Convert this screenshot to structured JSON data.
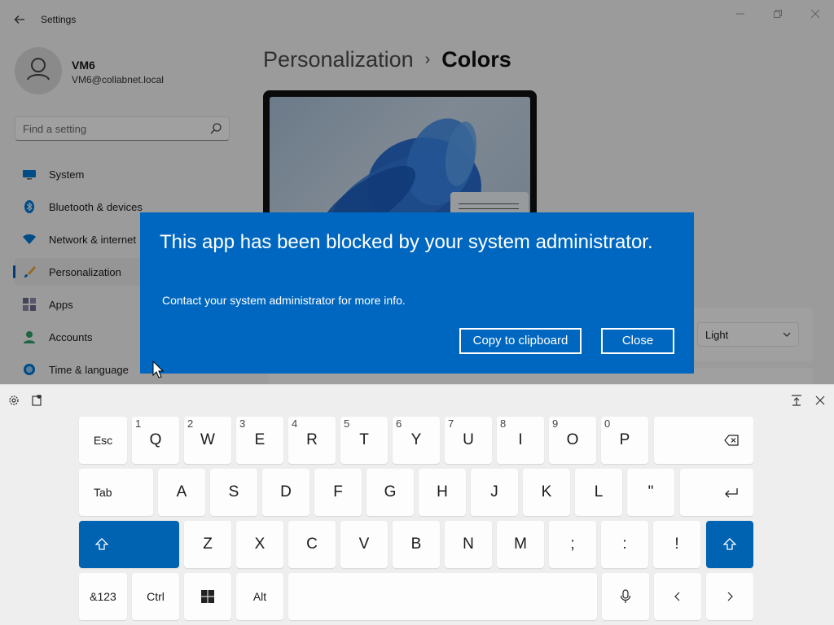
{
  "window": {
    "title": "Settings"
  },
  "profile": {
    "name": "VM6",
    "email": "VM6@collabnet.local"
  },
  "search": {
    "placeholder": "Find a setting"
  },
  "sidebar": {
    "items": [
      {
        "label": "System",
        "icon": "monitor-icon",
        "active": false
      },
      {
        "label": "Bluetooth & devices",
        "icon": "bluetooth-icon",
        "active": false
      },
      {
        "label": "Network & internet",
        "icon": "wifi-icon",
        "active": false
      },
      {
        "label": "Personalization",
        "icon": "brush-icon",
        "active": true
      },
      {
        "label": "Apps",
        "icon": "apps-icon",
        "active": false
      },
      {
        "label": "Accounts",
        "icon": "person-icon",
        "active": false
      },
      {
        "label": "Time & language",
        "icon": "globe-clock-icon",
        "active": false
      }
    ]
  },
  "breadcrumb": {
    "parent": "Personalization",
    "separator": "›",
    "current": "Colors"
  },
  "mode": {
    "value": "Light"
  },
  "dialog": {
    "title": "This app has been blocked by your system administrator.",
    "message": "Contact your system administrator for more info.",
    "copy_label": "Copy to clipboard",
    "close_label": "Close"
  },
  "keyboard": {
    "rows": [
      [
        {
          "label": "Esc"
        },
        {
          "label": "Q",
          "secondary": "1"
        },
        {
          "label": "W",
          "secondary": "2"
        },
        {
          "label": "E",
          "secondary": "3"
        },
        {
          "label": "R",
          "secondary": "4"
        },
        {
          "label": "T",
          "secondary": "5"
        },
        {
          "label": "Y",
          "secondary": "6"
        },
        {
          "label": "U",
          "secondary": "7"
        },
        {
          "label": "I",
          "secondary": "8"
        },
        {
          "label": "O",
          "secondary": "9"
        },
        {
          "label": "P",
          "secondary": "0"
        },
        {
          "label": "",
          "icon": "backspace-icon"
        }
      ],
      [
        {
          "label": "Tab"
        },
        {
          "label": "A"
        },
        {
          "label": "S"
        },
        {
          "label": "D"
        },
        {
          "label": "F"
        },
        {
          "label": "G"
        },
        {
          "label": "H"
        },
        {
          "label": "J"
        },
        {
          "label": "K"
        },
        {
          "label": "L"
        },
        {
          "label": "\""
        },
        {
          "label": "",
          "icon": "enter-icon"
        }
      ],
      [
        {
          "label": "",
          "icon": "shift-icon"
        },
        {
          "label": "Z"
        },
        {
          "label": "X"
        },
        {
          "label": "C"
        },
        {
          "label": "V"
        },
        {
          "label": "B"
        },
        {
          "label": "N"
        },
        {
          "label": "M"
        },
        {
          "label": ";"
        },
        {
          "label": ":"
        },
        {
          "label": "!"
        },
        {
          "label": "",
          "icon": "shift-icon"
        }
      ],
      [
        {
          "label": "&123"
        },
        {
          "label": "Ctrl"
        },
        {
          "label": "",
          "icon": "windows-icon"
        },
        {
          "label": "Alt"
        },
        {
          "label": "",
          "icon": "space-icon"
        },
        {
          "label": "",
          "icon": "microphone-icon"
        },
        {
          "label": "",
          "icon": "arrow-left-icon"
        },
        {
          "label": "",
          "icon": "arrow-right-icon"
        }
      ]
    ]
  },
  "colors": {
    "accent": "#0067c0",
    "key_accent": "#0063b1",
    "keyboard_bg": "#eeeeee"
  }
}
